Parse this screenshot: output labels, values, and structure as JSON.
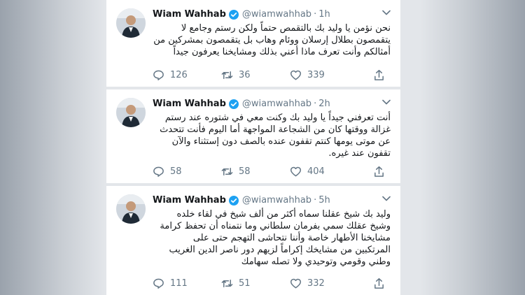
{
  "colors": {
    "verified": "#1da1f2",
    "text": "#14171a",
    "muted": "#657786"
  },
  "tweets": [
    {
      "name": "Wiam Wahhab",
      "handle": "@wiamwahhab",
      "separator": "·",
      "time": "1h",
      "text": "نحن نؤمن يا وليد بك بالتقمص حتماً ولكن رستم وجامع لا\nيتقمصون بطلال إرسلان ووئام وهاب بل يتقمصون بمشركين من\nأمثالكم وأنت تعرف ماذا أعني بذلك ومشايخنا يعرفون جيداً",
      "replies": "126",
      "retweets": "36",
      "likes": "339"
    },
    {
      "name": "Wiam Wahhab",
      "handle": "@wiamwahhab",
      "separator": "·",
      "time": "2h",
      "text": "أنت تعرفني جيداً يا وليد بك وكنت معي في شتوره عند رستم\nغزالة ووقتها كان من الشجاعة المواجهة أما اليوم فأنت تتحدث\nعن موتى يومها كنتم تقفون عنده بالصف دون إستثناء والآن\nتقفون عند غيره.",
      "replies": "58",
      "retweets": "58",
      "likes": "404"
    },
    {
      "name": "Wiam Wahhab",
      "handle": "@wiamwahhab",
      "separator": "·",
      "time": "5h",
      "text": "وليد بك شيخ عقلنا سماه أكثر من ألف شيخ في لقاء خلده\nوشيخ عقلك سمي بفرمان سلطاني وما نتمناه أن تحفظ كرامة\nمشايخنا الأطهار خاصة وأننا نتحاشى التهجم حتى على\nالمرتكبين من مشايخك إكراماً لزيهم دور ناصر الدين الغريب\nوطني وقومي وتوحيدي ولا تصله سهامك",
      "replies": "111",
      "retweets": "51",
      "likes": "332"
    }
  ]
}
